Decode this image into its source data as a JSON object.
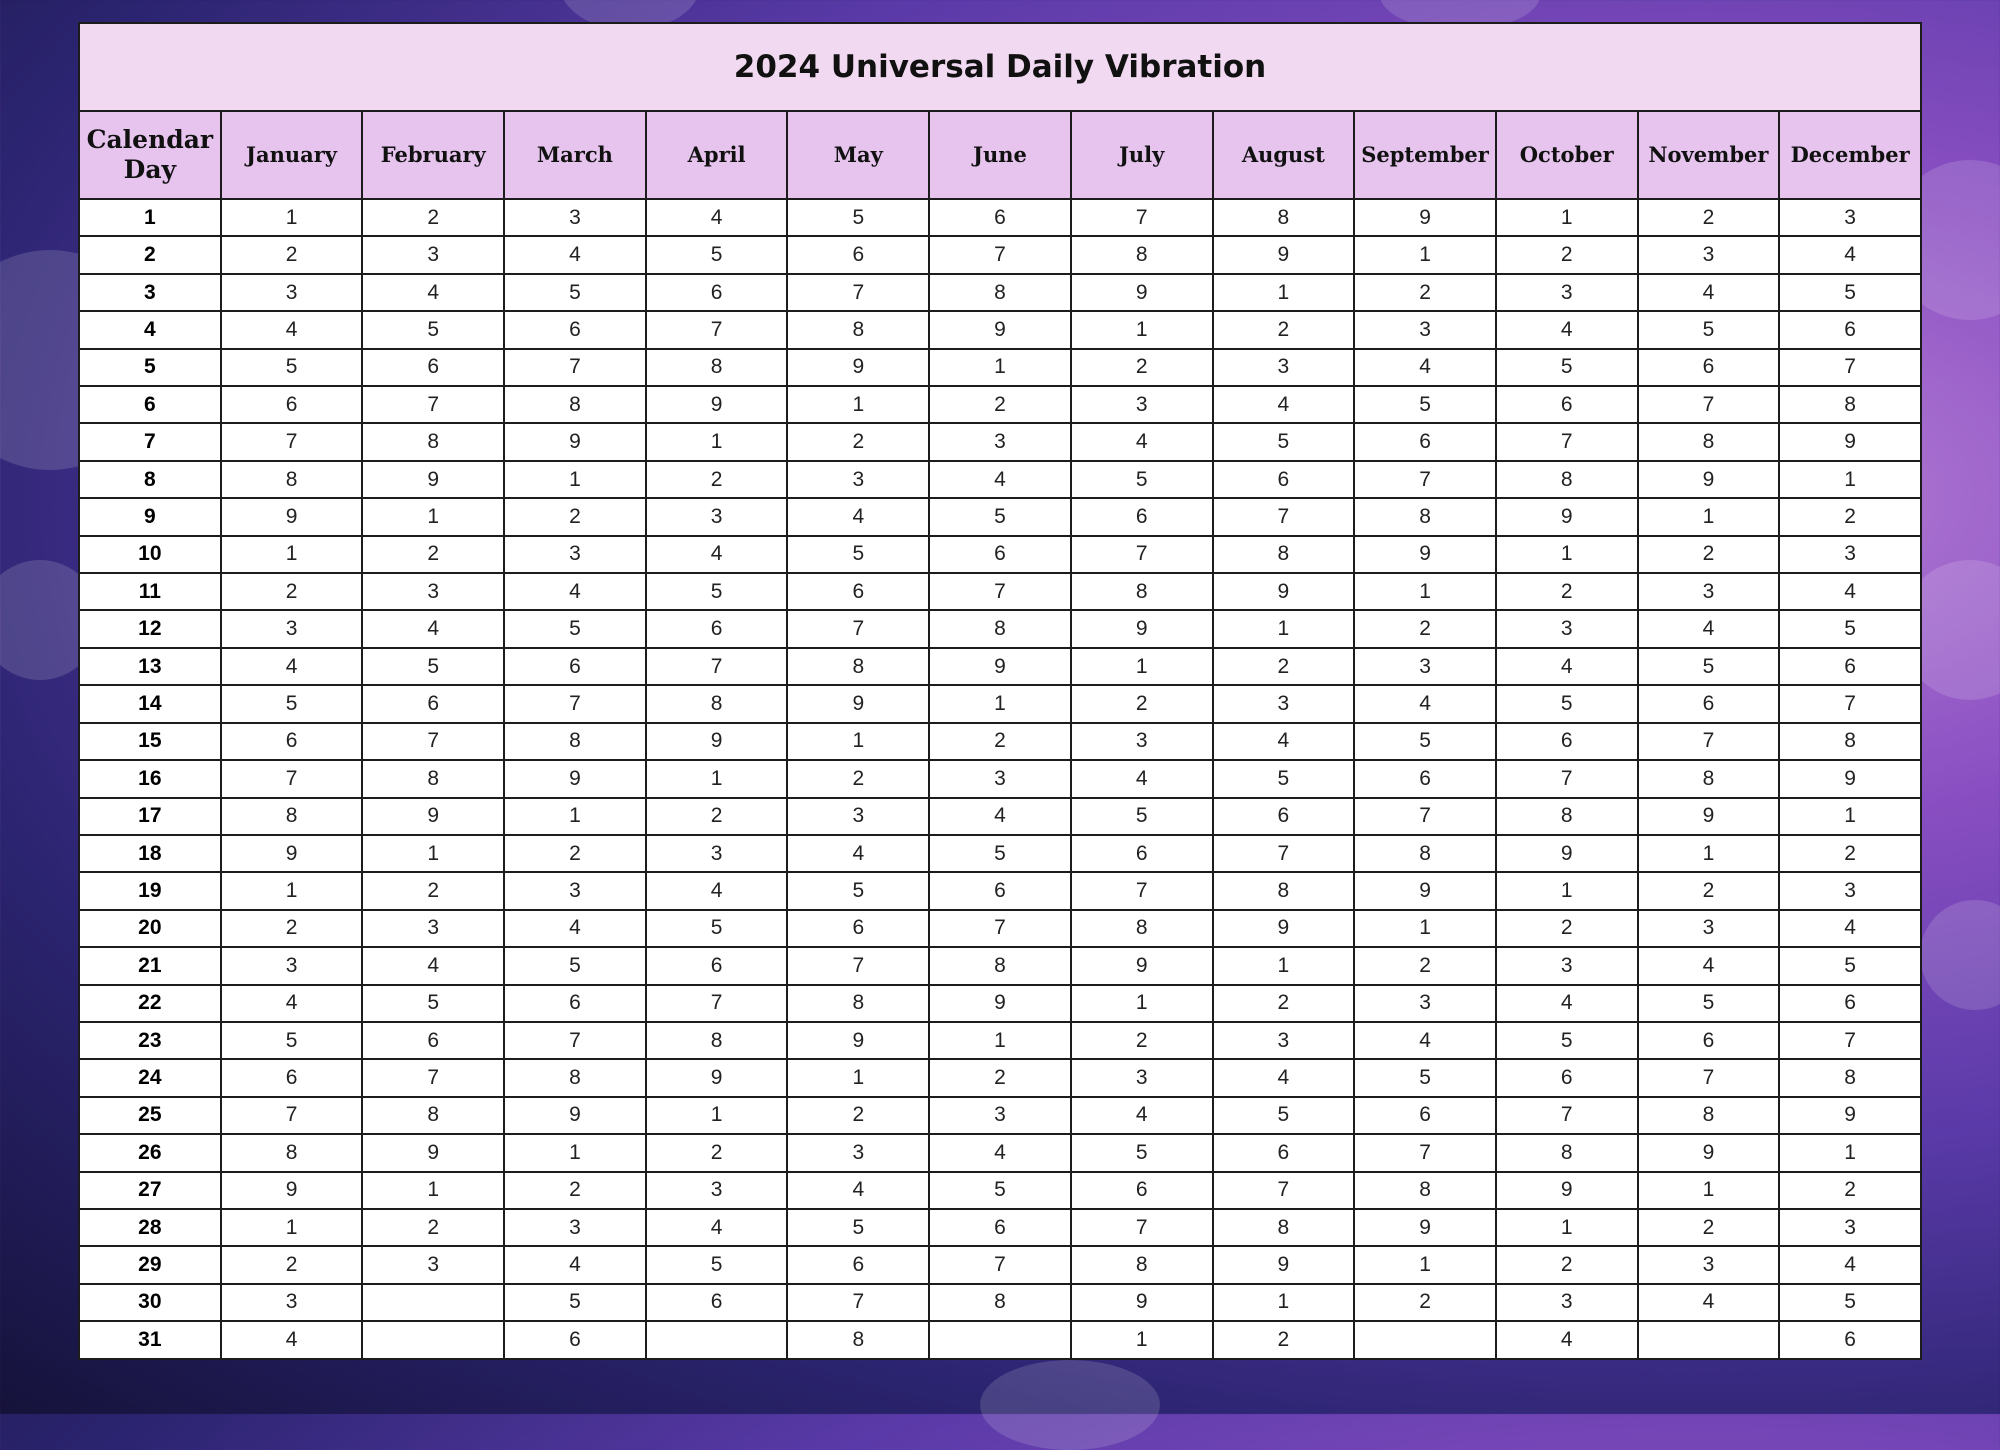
{
  "title": "2024 Universal Daily Vibration",
  "first_header": "Calendar Day",
  "months": [
    "January",
    "February",
    "March",
    "April",
    "May",
    "June",
    "July",
    "August",
    "September",
    "October",
    "November",
    "December"
  ],
  "rows": [
    [
      "1",
      "1",
      "2",
      "3",
      "4",
      "5",
      "6",
      "7",
      "8",
      "9",
      "1",
      "2",
      "3"
    ],
    [
      "2",
      "2",
      "3",
      "4",
      "5",
      "6",
      "7",
      "8",
      "9",
      "1",
      "2",
      "3",
      "4"
    ],
    [
      "3",
      "3",
      "4",
      "5",
      "6",
      "7",
      "8",
      "9",
      "1",
      "2",
      "3",
      "4",
      "5"
    ],
    [
      "4",
      "4",
      "5",
      "6",
      "7",
      "8",
      "9",
      "1",
      "2",
      "3",
      "4",
      "5",
      "6"
    ],
    [
      "5",
      "5",
      "6",
      "7",
      "8",
      "9",
      "1",
      "2",
      "3",
      "4",
      "5",
      "6",
      "7"
    ],
    [
      "6",
      "6",
      "7",
      "8",
      "9",
      "1",
      "2",
      "3",
      "4",
      "5",
      "6",
      "7",
      "8"
    ],
    [
      "7",
      "7",
      "8",
      "9",
      "1",
      "2",
      "3",
      "4",
      "5",
      "6",
      "7",
      "8",
      "9"
    ],
    [
      "8",
      "8",
      "9",
      "1",
      "2",
      "3",
      "4",
      "5",
      "6",
      "7",
      "8",
      "9",
      "1"
    ],
    [
      "9",
      "9",
      "1",
      "2",
      "3",
      "4",
      "5",
      "6",
      "7",
      "8",
      "9",
      "1",
      "2"
    ],
    [
      "10",
      "1",
      "2",
      "3",
      "4",
      "5",
      "6",
      "7",
      "8",
      "9",
      "1",
      "2",
      "3"
    ],
    [
      "11",
      "2",
      "3",
      "4",
      "5",
      "6",
      "7",
      "8",
      "9",
      "1",
      "2",
      "3",
      "4"
    ],
    [
      "12",
      "3",
      "4",
      "5",
      "6",
      "7",
      "8",
      "9",
      "1",
      "2",
      "3",
      "4",
      "5"
    ],
    [
      "13",
      "4",
      "5",
      "6",
      "7",
      "8",
      "9",
      "1",
      "2",
      "3",
      "4",
      "5",
      "6"
    ],
    [
      "14",
      "5",
      "6",
      "7",
      "8",
      "9",
      "1",
      "2",
      "3",
      "4",
      "5",
      "6",
      "7"
    ],
    [
      "15",
      "6",
      "7",
      "8",
      "9",
      "1",
      "2",
      "3",
      "4",
      "5",
      "6",
      "7",
      "8"
    ],
    [
      "16",
      "7",
      "8",
      "9",
      "1",
      "2",
      "3",
      "4",
      "5",
      "6",
      "7",
      "8",
      "9"
    ],
    [
      "17",
      "8",
      "9",
      "1",
      "2",
      "3",
      "4",
      "5",
      "6",
      "7",
      "8",
      "9",
      "1"
    ],
    [
      "18",
      "9",
      "1",
      "2",
      "3",
      "4",
      "5",
      "6",
      "7",
      "8",
      "9",
      "1",
      "2"
    ],
    [
      "19",
      "1",
      "2",
      "3",
      "4",
      "5",
      "6",
      "7",
      "8",
      "9",
      "1",
      "2",
      "3"
    ],
    [
      "20",
      "2",
      "3",
      "4",
      "5",
      "6",
      "7",
      "8",
      "9",
      "1",
      "2",
      "3",
      "4"
    ],
    [
      "21",
      "3",
      "4",
      "5",
      "6",
      "7",
      "8",
      "9",
      "1",
      "2",
      "3",
      "4",
      "5"
    ],
    [
      "22",
      "4",
      "5",
      "6",
      "7",
      "8",
      "9",
      "1",
      "2",
      "3",
      "4",
      "5",
      "6"
    ],
    [
      "23",
      "5",
      "6",
      "7",
      "8",
      "9",
      "1",
      "2",
      "3",
      "4",
      "5",
      "6",
      "7"
    ],
    [
      "24",
      "6",
      "7",
      "8",
      "9",
      "1",
      "2",
      "3",
      "4",
      "5",
      "6",
      "7",
      "8"
    ],
    [
      "25",
      "7",
      "8",
      "9",
      "1",
      "2",
      "3",
      "4",
      "5",
      "6",
      "7",
      "8",
      "9"
    ],
    [
      "26",
      "8",
      "9",
      "1",
      "2",
      "3",
      "4",
      "5",
      "6",
      "7",
      "8",
      "9",
      "1"
    ],
    [
      "27",
      "9",
      "1",
      "2",
      "3",
      "4",
      "5",
      "6",
      "7",
      "8",
      "9",
      "1",
      "2"
    ],
    [
      "28",
      "1",
      "2",
      "3",
      "4",
      "5",
      "6",
      "7",
      "8",
      "9",
      "1",
      "2",
      "3"
    ],
    [
      "29",
      "2",
      "3",
      "4",
      "5",
      "6",
      "7",
      "8",
      "9",
      "1",
      "2",
      "3",
      "4"
    ],
    [
      "30",
      "3",
      "",
      "5",
      "6",
      "7",
      "8",
      "9",
      "1",
      "2",
      "3",
      "4",
      "5"
    ],
    [
      "31",
      "4",
      "",
      "6",
      "",
      "8",
      "",
      "1",
      "2",
      "",
      "4",
      "",
      "6"
    ]
  ],
  "colors": {
    "title_bg": "#f2d9f2",
    "header_bg": "#e6c4ee",
    "background": "#5a3aa8"
  }
}
